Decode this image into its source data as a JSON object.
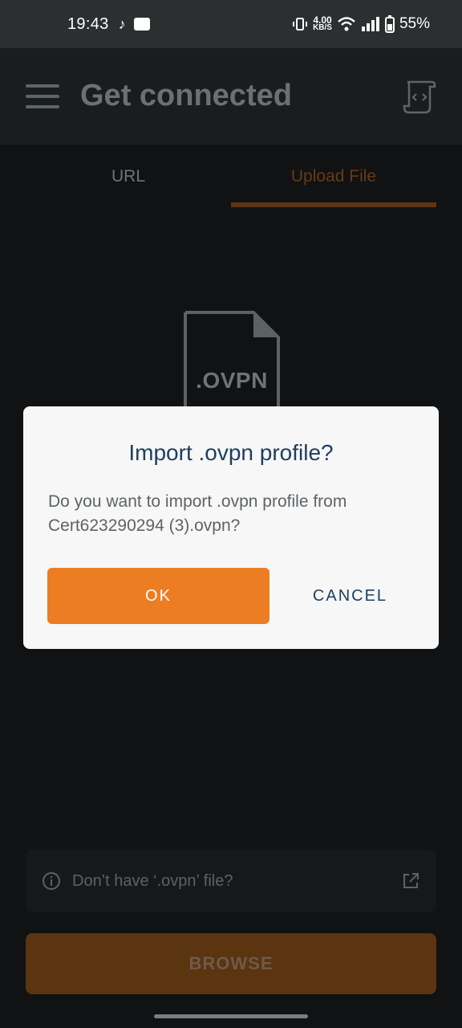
{
  "status_bar": {
    "time": "19:43",
    "net_speed_value": "4.00",
    "net_speed_unit": "KB/S",
    "battery": "55%"
  },
  "header": {
    "title": "Get connected"
  },
  "tabs": [
    {
      "label": "URL",
      "active": false
    },
    {
      "label": "Upload File",
      "active": true
    }
  ],
  "file_placeholder": {
    "label": ".OVPN"
  },
  "help": {
    "text": "Don’t have ‘.ovpn’ file?"
  },
  "browse_button": {
    "label": "BROWSE"
  },
  "dialog": {
    "title": "Import .ovpn profile?",
    "message": "Do you want to import .ovpn profile from Cert623290294 (3).ovpn?",
    "ok_label": "OK",
    "cancel_label": "CANCEL"
  },
  "colors": {
    "accent": "#ed7d22",
    "dialog_title": "#1f3d5f"
  }
}
